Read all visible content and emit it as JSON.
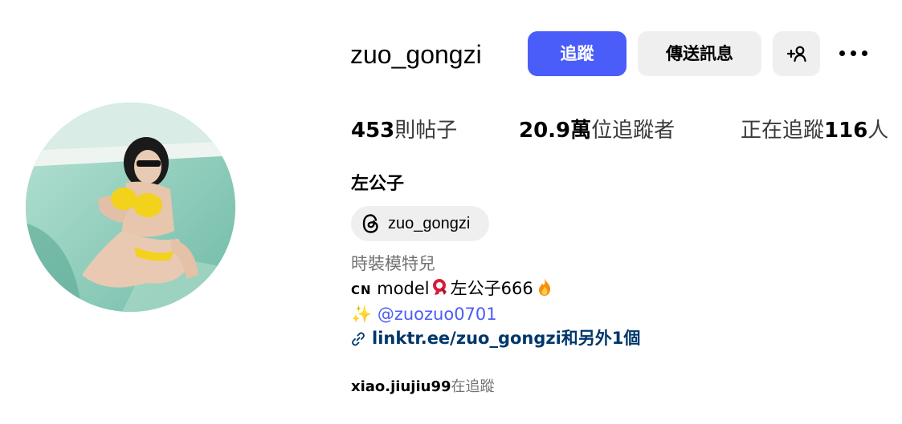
{
  "profile": {
    "username": "zuo_gongzi",
    "full_name": "左公子",
    "category": "時裝模特兒",
    "avatar_icon": "profile-photo"
  },
  "actions": {
    "follow_label": "追蹤",
    "message_label": "傳送訊息",
    "suggest_icon": "add-person-icon",
    "more_icon": "more-options-icon"
  },
  "stats": {
    "posts_count": "453",
    "posts_label": "則帖子",
    "followers_count": "20.9萬",
    "followers_label": "位追蹤者",
    "following_prefix": "正在追蹤",
    "following_count": "116",
    "following_suffix": "人"
  },
  "threads": {
    "icon": "threads-icon",
    "handle": "zuo_gongzi"
  },
  "bio": {
    "line1_prefix": "CN",
    "line1_text": " model",
    "line1_name": "左公子666",
    "line2_sparkle": "✨",
    "line2_mention": " @zuozuo0701"
  },
  "link": {
    "icon": "link-icon",
    "text": "linktr.ee/zuo_gongzi和另外1個"
  },
  "followed_by": {
    "user": "xiao.jiujiu99",
    "text": "在追蹤"
  },
  "colors": {
    "follow_button": "#4a5df9",
    "secondary_button": "#efefef",
    "link": "#00376b",
    "mention": "#4a5df9",
    "muted_text": "#737373"
  }
}
